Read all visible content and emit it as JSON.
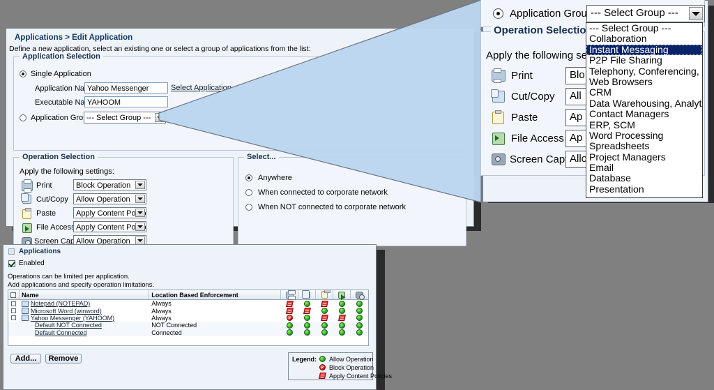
{
  "main_window": {
    "breadcrumb": "Applications > Edit Application",
    "description": "Define a new application, select an existing one or select a group of applications from the list:",
    "application_selection": {
      "title": "Application Selection",
      "single_application_label": "Single Application",
      "single_application_selected": true,
      "application_name_label": "Application Name:",
      "application_name_value": "Yahoo Messenger",
      "select_application_link": "Select Application",
      "executable_name_label": "Executable Name:",
      "executable_name_value": "YAHOOM",
      "application_group_label": "Application Group",
      "application_group_selected": false,
      "application_group_value": "--- Select Group ---"
    },
    "operation_selection": {
      "title": "Operation Selection",
      "subtitle": "Apply the following settings:",
      "rows": [
        {
          "icon": "printer-icon",
          "label": "Print",
          "value": "Block Operation"
        },
        {
          "icon": "cut-copy-icon",
          "label": "Cut/Copy",
          "value": "Allow Operation"
        },
        {
          "icon": "paste-icon",
          "label": "Paste",
          "value": "Apply Content Policies"
        },
        {
          "icon": "file-access-icon",
          "label": "File Access",
          "value": "Apply Content Policies"
        },
        {
          "icon": "screen-capture-icon",
          "label": "Screen Capture",
          "value": "Allow Operation"
        }
      ]
    },
    "location_selection": {
      "title": "Select...",
      "options": [
        {
          "label": "Anywhere",
          "selected": true
        },
        {
          "label": "When connected to corporate network",
          "selected": false
        },
        {
          "label": "When NOT connected to corporate network",
          "selected": false
        }
      ]
    }
  },
  "magnified_panel": {
    "application_group_label": "Application Group",
    "application_group_selected": true,
    "combo_value": "--- Select Group ---",
    "operation_selection_title": "Operation Selection",
    "operation_subtitle": "Apply the following settin",
    "rows": [
      {
        "icon": "printer-icon",
        "label": "Print",
        "value": "Blo"
      },
      {
        "icon": "cut-copy-icon",
        "label": "Cut/Copy",
        "value": "All"
      },
      {
        "icon": "paste-icon",
        "label": "Paste",
        "value": "Ap"
      },
      {
        "icon": "file-access-icon",
        "label": "File Access",
        "value": "Ap"
      },
      {
        "icon": "screen-capture-icon",
        "label": "Screen Capture",
        "value": "Allo"
      }
    ],
    "dropdown_options": [
      {
        "label": "--- Select Group ---",
        "highlighted": false
      },
      {
        "label": "Collaboration",
        "highlighted": false
      },
      {
        "label": "Instant Messaging",
        "highlighted": true
      },
      {
        "label": "P2P File Sharing",
        "highlighted": false
      },
      {
        "label": "Telephony, Conferencing, ..",
        "highlighted": false
      },
      {
        "label": "Web Browsers",
        "highlighted": false
      },
      {
        "label": "CRM",
        "highlighted": false
      },
      {
        "label": "Data Warehousing, Analyti..",
        "highlighted": false
      },
      {
        "label": "Contact Managers",
        "highlighted": false
      },
      {
        "label": "ERP, SCM",
        "highlighted": false
      },
      {
        "label": "Word Processing",
        "highlighted": false
      },
      {
        "label": "Spreadsheets",
        "highlighted": false
      },
      {
        "label": "Project Managers",
        "highlighted": false
      },
      {
        "label": "Email",
        "highlighted": false
      },
      {
        "label": "Database",
        "highlighted": false
      },
      {
        "label": "Presentation",
        "highlighted": false
      }
    ]
  },
  "applications_window": {
    "title": "Applications",
    "enabled_label": "Enabled",
    "enabled_checked": true,
    "info_line_1": "Operations can be limited per application.",
    "info_line_2": "Add applications and specify operation limitations.",
    "grid": {
      "columns": [
        {
          "key": "check",
          "label": ""
        },
        {
          "key": "name",
          "label": "Name"
        },
        {
          "key": "location",
          "label": "Location Based Enforcement"
        },
        {
          "key": "print",
          "label": "printer-icon"
        },
        {
          "key": "cutcopy",
          "label": "cut-copy-icon"
        },
        {
          "key": "paste",
          "label": "paste-icon"
        },
        {
          "key": "fileaccess",
          "label": "file-access-icon"
        },
        {
          "key": "screencapture",
          "label": "screen-capture-icon"
        }
      ],
      "rows": [
        {
          "name": "Notepad (NOTEPAD)",
          "has_icon": true,
          "checkbox": true,
          "location": "Always",
          "ops": [
            "policy",
            "allow",
            "policy",
            "allow",
            "allow"
          ]
        },
        {
          "name": "Microsoft Word (winword)",
          "has_icon": true,
          "checkbox": true,
          "location": "Always",
          "ops": [
            "policy",
            "policy",
            "allow",
            "allow",
            "allow"
          ]
        },
        {
          "name": "Yahoo Messenger (YAHOOM)",
          "has_icon": true,
          "checkbox": true,
          "location": "Always",
          "ops": [
            "block",
            "allow",
            "policy",
            "policy",
            "allow"
          ]
        },
        {
          "name": "Default NOT Connected",
          "has_icon": false,
          "checkbox": false,
          "location": "NOT Connected",
          "ops": [
            "allow",
            "allow",
            "allow",
            "allow",
            "allow"
          ]
        },
        {
          "name": "Default Connected",
          "has_icon": false,
          "checkbox": false,
          "location": "Connected",
          "ops": [
            "allow",
            "allow",
            "allow",
            "allow",
            "allow"
          ]
        }
      ]
    },
    "buttons": [
      {
        "label": "Add...",
        "name": "add-button"
      },
      {
        "label": "Remove",
        "name": "remove-button"
      }
    ],
    "legend": {
      "title": "Legend:",
      "items": [
        {
          "glyph": "allow",
          "label": "Allow Operation"
        },
        {
          "glyph": "block",
          "label": "Block Operation"
        },
        {
          "glyph": "policy",
          "label": "Apply Content Policies"
        }
      ]
    }
  },
  "colors": {
    "desktop": "#808080",
    "window_bg": "#eef3fa",
    "group_bg": "#f2f6fc",
    "shadow": "#2b2b2b",
    "magnifier_fill": "#bcd6ef",
    "highlight": "#0a246a",
    "allow": "#1f9e1f",
    "block": "#cc1111",
    "policy": "#e03b3b"
  }
}
